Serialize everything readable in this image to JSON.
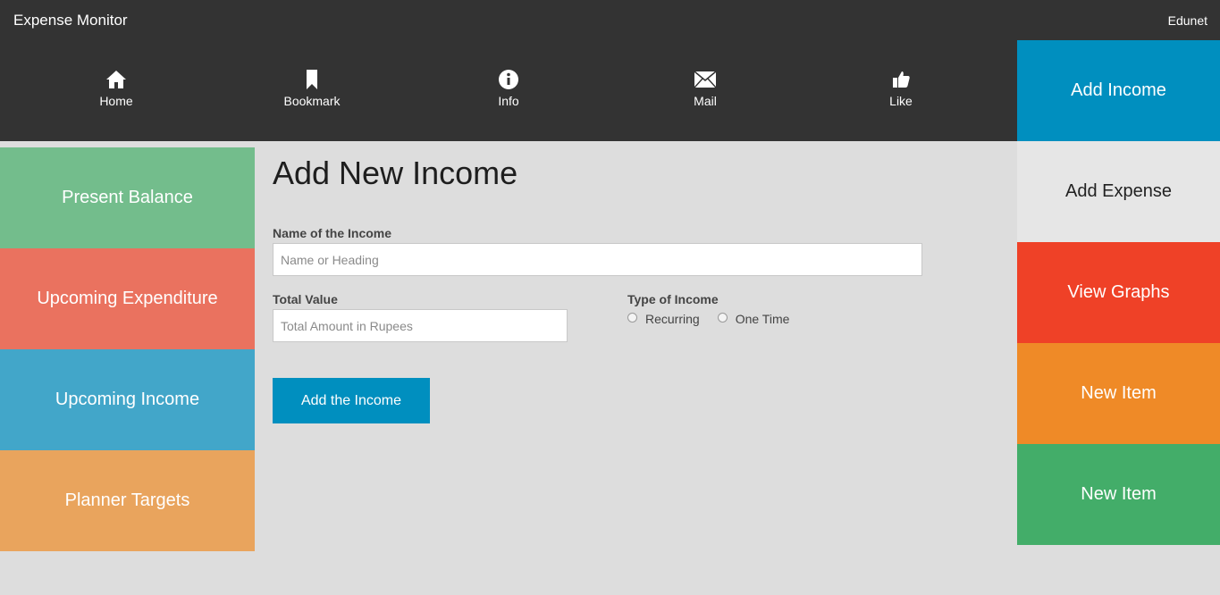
{
  "app": {
    "title": "Expense Monitor",
    "user": "Edunet"
  },
  "nav": [
    {
      "label": "Home",
      "icon": "home-icon"
    },
    {
      "label": "Bookmark",
      "icon": "bookmark-icon"
    },
    {
      "label": "Info",
      "icon": "info-icon"
    },
    {
      "label": "Mail",
      "icon": "mail-icon"
    },
    {
      "label": "Like",
      "icon": "thumbs-up-icon"
    }
  ],
  "left_tiles": [
    {
      "label": "Present Balance",
      "color": "#73bd8c"
    },
    {
      "label": "Upcoming Expenditure",
      "color": "#ea725f"
    },
    {
      "label": "Upcoming Income",
      "color": "#42a6c9"
    },
    {
      "label": "Planner Targets",
      "color": "#e9a45d"
    }
  ],
  "right_tiles": [
    {
      "label": "Add Income",
      "color": "#008fbf"
    },
    {
      "label": "Add Expense",
      "color": "#e6e6e6"
    },
    {
      "label": "View Graphs",
      "color": "#ef4127"
    },
    {
      "label": "New Item",
      "color": "#ef8a27"
    },
    {
      "label": "New Item",
      "color": "#43ad69"
    }
  ],
  "form": {
    "title": "Add New Income",
    "name_label": "Name of the Income",
    "name_placeholder": "Name or Heading",
    "name_value": "",
    "value_label": "Total Value",
    "value_placeholder": "Total Amount in Rupees",
    "value_value": "",
    "type_label": "Type of Income",
    "type_options": [
      "Recurring",
      "One Time"
    ],
    "submit_label": "Add the Income"
  }
}
